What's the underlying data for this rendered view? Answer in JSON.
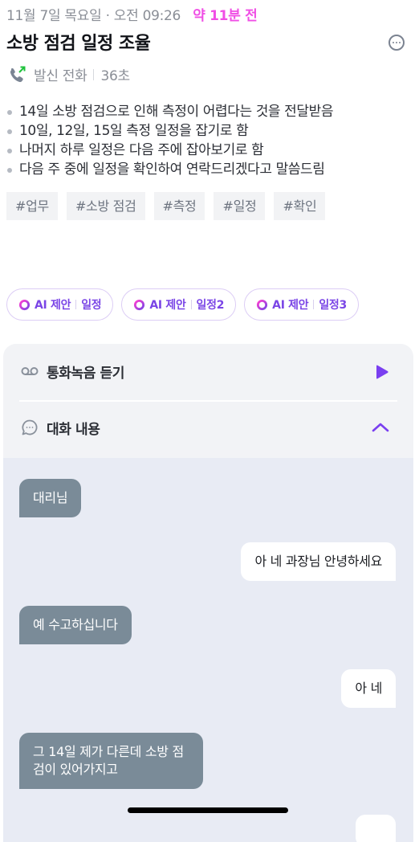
{
  "header": {
    "date": "11월 7일 목요일",
    "separator": "·",
    "time": "오전 09:26",
    "relative_time": "약 11분 전",
    "title": "소방 점검 일정 조율",
    "more_icon": "more-horizontal-circle-icon"
  },
  "call": {
    "icon": "outgoing-call-icon",
    "type": "발신 전화",
    "duration": "36초"
  },
  "summary": [
    "14일 소방 점검으로 인해 측정이 어렵다는 것을 전달받음",
    "10일, 12일, 15일 측정 일정을 잡기로 함",
    "나머지 하루 일정은 다음 주에 잡아보기로 함",
    "다음 주 중에 일정을 확인하여 연락드리겠다고 말씀드림"
  ],
  "tags": [
    "#업무",
    "#소방 점검",
    "#측정",
    "#일정",
    "#확인"
  ],
  "ai_suggestions": [
    {
      "prefix": "AI 제안",
      "label": "일정"
    },
    {
      "prefix": "AI 제안",
      "label": "일정2"
    },
    {
      "prefix": "AI 제안",
      "label": "일정3"
    }
  ],
  "card": {
    "recording_label": "통화녹음 듣기",
    "conversation_label": "대화 내용"
  },
  "messages": [
    {
      "side": "left",
      "text": "대리님"
    },
    {
      "side": "right",
      "text": "아 네 과장님 안녕하세요"
    },
    {
      "side": "left",
      "text": "예 수고하십니다"
    },
    {
      "side": "right",
      "text": "아 네"
    },
    {
      "side": "left",
      "text": "그 14일 제가 다른데 소방 점검이 있어가지고"
    }
  ],
  "colors": {
    "accent_purple": "#7a45e6",
    "relative_time_pink": "#f04ee5",
    "left_bubble": "#7a8b98",
    "conversation_bg": "#e8ebf4"
  }
}
